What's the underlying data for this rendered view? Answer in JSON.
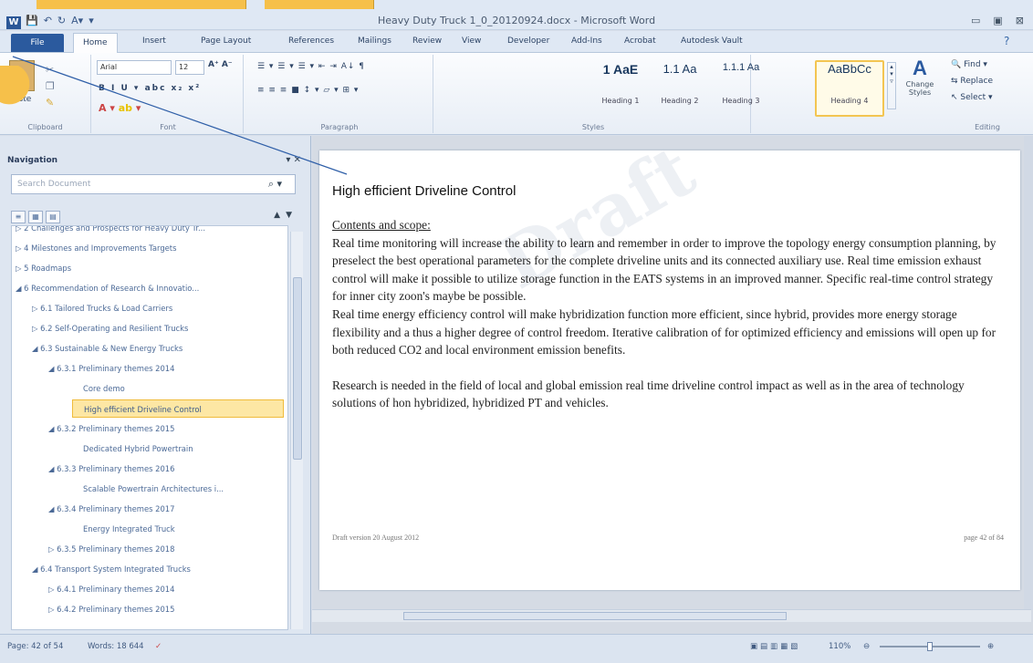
{
  "window": {
    "title": "Heavy Duty Truck 1_0_20120924.docx - Microsoft Word",
    "qat": [
      "💾",
      "↶",
      "↻",
      "A▾",
      "▾"
    ],
    "controls": [
      "▭",
      "▣",
      "⊠"
    ]
  },
  "tabs": [
    "File",
    "Home",
    "Insert",
    "Page Layout",
    "References",
    "Mailings",
    "Review",
    "View",
    "Developer",
    "Add-Ins",
    "Acrobat",
    "Autodesk Vault"
  ],
  "ribbon": {
    "clipboard": {
      "label": "Clipboard",
      "paste": "Paste"
    },
    "font": {
      "label": "Font",
      "name": "Arial",
      "size": "12",
      "row2": "B I U ▾ abc x₂ x²"
    },
    "paragraph": {
      "label": "Paragraph",
      "row1": "☰ ▾ ☰ ▾ ☰ ▾  ⇤ ⇥  A↓  ¶",
      "row2": "≡ ≡ ≡ ■  ↕ ▾  ▱ ▾ ⊞ ▾"
    },
    "styles": {
      "label": "Styles",
      "items": [
        {
          "sample": "1 AaE",
          "label": "Heading 1"
        },
        {
          "sample": "1.1 Aa",
          "label": "Heading 2"
        },
        {
          "sample": "1.1.1 Aa",
          "label": "Heading 3"
        },
        {
          "sample": "AaBbCc",
          "label": "Heading 4"
        }
      ],
      "change": "Change Styles"
    },
    "editing": {
      "label": "Editing",
      "find": "Find",
      "replace": "Replace",
      "select": "Select"
    }
  },
  "nav": {
    "title": "Navigation",
    "search_placeholder": "Search Document",
    "items": [
      "2 Challenges and Prospects for Heavy Duty Tr...",
      "4 Milestones and Improvements Targets",
      "5 Roadmaps",
      "6 Recommendation of Research & Innovatio...",
      "6.1 Tailored Trucks & Load Carriers",
      "6.2 Self-Operating and Resilient Trucks",
      "6.3 Sustainable & New Energy Trucks",
      "6.3.1 Preliminary themes 2014",
      "Core demo",
      "High efficient Driveline Control",
      "6.3.2 Preliminary themes 2015",
      "Dedicated Hybrid Powertrain",
      "6.3.3 Preliminary themes 2016",
      "Scalable Powertrain Architectures i...",
      "6.3.4 Preliminary themes 2017",
      "Energy Integrated Truck",
      "6.3.5 Preliminary themes 2018",
      "6.4 Transport System Integrated Trucks",
      "6.4.1 Preliminary themes 2014",
      "6.4.2 Preliminary themes 2015"
    ]
  },
  "doc": {
    "watermark": "Draft",
    "title": "High efficient Driveline Control",
    "section_heading": "Contents and scope:",
    "para1": "Real time monitoring will increase the ability to learn and remember in order to improve the topology energy consumption planning, by preselect the best operational parameters for the complete driveline units and its connected auxiliary use.  Real time emission exhaust control will make it possible to utilize storage function in the EATS systems in an improved manner. Specific real-time control strategy for inner city zoon's maybe be possible.",
    "para2": "Real time energy efficiency control will make hybridization function more efficient, since hybrid, provides more energy storage flexibility and a thus a higher degree of control freedom.  Iterative calibration of for optimized efficiency and emissions will open up for both reduced CO2 and local environment emission benefits.",
    "para3": "Research is needed in the field of local and global emission real time driveline control impact as well as in the area of technology solutions of hon hybridized, hybridized PT and vehicles.",
    "footer_left": "Draft version 20 August 2012",
    "footer_right": "page 42 of 84"
  },
  "status": {
    "page": "Page: 42 of 54",
    "words": "Words: 18 644",
    "zoom": "110%"
  }
}
